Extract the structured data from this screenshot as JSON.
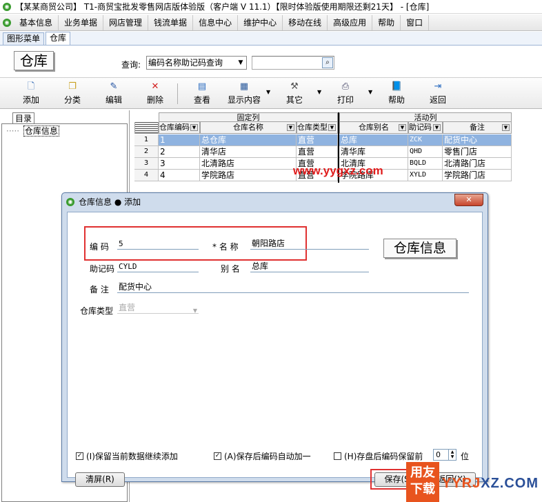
{
  "window": {
    "title": "【某某商贸公司】 T1-商贸宝批发零售网店版体验版（客户端 V 11.1）【限时体验版使用期限还剩21天】 - [仓库]"
  },
  "menubar": [
    "基本信息",
    "业务单据",
    "网店管理",
    "钱流单据",
    "信息中心",
    "维护中心",
    "移动在线",
    "高级应用",
    "帮助",
    "窗口"
  ],
  "tabs": [
    {
      "label": "图形菜单",
      "active": false
    },
    {
      "label": "仓库",
      "active": true
    }
  ],
  "header": {
    "module_title": "仓库",
    "query_label": "查询:",
    "query_mode": "编码名称助记码查询",
    "query_value": ""
  },
  "toolbar": {
    "add": "添加",
    "category": "分类",
    "edit": "编辑",
    "delete": "删除",
    "view": "查看",
    "display": "显示内容",
    "other": "其它",
    "print": "打印",
    "help": "帮助",
    "back": "返回"
  },
  "tree": {
    "tab": "目录",
    "root": "仓库信息"
  },
  "grid": {
    "group_fixed": "固定列",
    "group_active": "活动列",
    "columns": [
      "仓库编码",
      "仓库名称",
      "仓库类型",
      "仓库别名",
      "助记码",
      "备注"
    ],
    "rows": [
      {
        "no": "1",
        "code": "1",
        "name": "总仓库",
        "type": "直营",
        "alias": "总库",
        "mnemonic": "ZCK",
        "note": "配货中心"
      },
      {
        "no": "2",
        "code": "2",
        "name": "清华店",
        "type": "直营",
        "alias": "清华库",
        "mnemonic": "QHD",
        "note": "零售门店"
      },
      {
        "no": "3",
        "code": "3",
        "name": "北清路店",
        "type": "直营",
        "alias": "北清库",
        "mnemonic": "BQLD",
        "note": "北清路门店"
      },
      {
        "no": "4",
        "code": "4",
        "name": "学院路店",
        "type": "直营",
        "alias": "学院路库",
        "mnemonic": "XYLD",
        "note": "学院路门店"
      }
    ],
    "selected_row": 0
  },
  "watermark": "www.yygxz.com",
  "dialog": {
    "title": "仓库信息 ● 添加",
    "close_glyph": "✕",
    "info_logo": "仓库信息",
    "labels": {
      "code": "编  码",
      "name": "* 名  称",
      "mnemonic": "助记码",
      "alias": "别  名",
      "note": "备  注",
      "type": "仓库类型"
    },
    "values": {
      "code": "5",
      "name": "朝阳路店",
      "mnemonic": "CYLD",
      "alias": "总库",
      "note": "配货中心",
      "type": "直营"
    },
    "options": {
      "keep_data": "(I)保留当前数据继续添加",
      "auto_increment": "(A)保存后编码自动加一",
      "keep_prefix": "(H)存盘后编码保留前",
      "prefix_digits": "0",
      "prefix_unit": "位"
    },
    "checks": {
      "keep_data": true,
      "auto_increment": true,
      "keep_prefix": false
    },
    "buttons": {
      "clear": "清屏(R)",
      "save": "保存(S)",
      "back": "返回(X)"
    }
  },
  "brand": {
    "badge_line1": "用友",
    "badge_line2": "下载",
    "text_part1": "YYRJ",
    "text_part2": "XZ.COM"
  }
}
